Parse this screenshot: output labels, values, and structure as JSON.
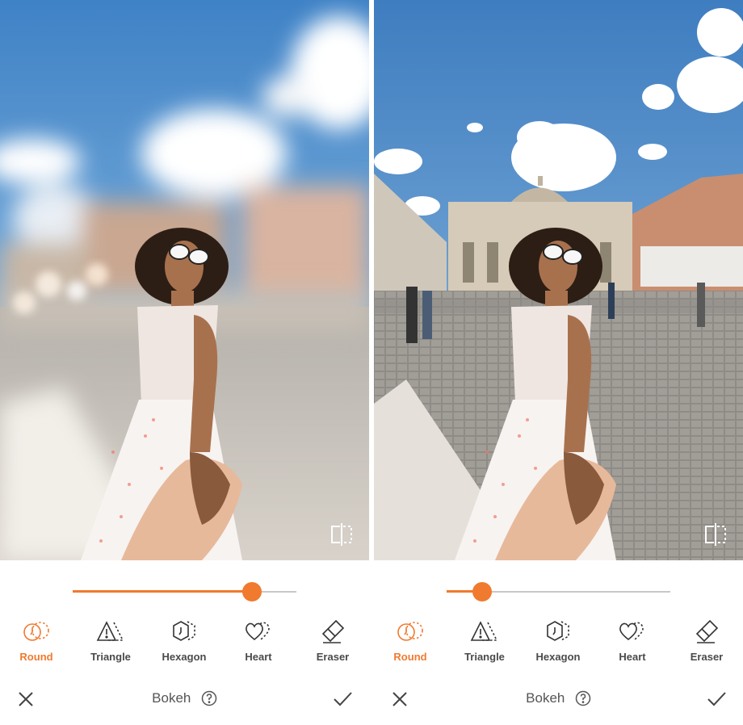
{
  "screens": [
    {
      "id": "left",
      "photo_variant": "bokeh-blurred",
      "slider_value": 0.8,
      "tools": [
        {
          "label": "Round",
          "icon": "round-bokeh-icon",
          "active": true
        },
        {
          "label": "Triangle",
          "icon": "triangle-bokeh-icon",
          "active": false
        },
        {
          "label": "Hexagon",
          "icon": "hexagon-bokeh-icon",
          "active": false
        },
        {
          "label": "Heart",
          "icon": "heart-bokeh-icon",
          "active": false
        },
        {
          "label": "Eraser",
          "icon": "eraser-icon",
          "active": false
        }
      ],
      "title": "Bokeh"
    },
    {
      "id": "right",
      "photo_variant": "original-sharp",
      "slider_value": 0.16,
      "tools": [
        {
          "label": "Round",
          "icon": "round-bokeh-icon",
          "active": true
        },
        {
          "label": "Triangle",
          "icon": "triangle-bokeh-icon",
          "active": false
        },
        {
          "label": "Hexagon",
          "icon": "hexagon-bokeh-icon",
          "active": false
        },
        {
          "label": "Heart",
          "icon": "heart-bokeh-icon",
          "active": false
        },
        {
          "label": "Eraser",
          "icon": "eraser-icon",
          "active": false
        }
      ],
      "title": "Bokeh"
    }
  ],
  "colors": {
    "accent": "#f07a2e",
    "sky": "#5b97d2",
    "text": "#4a4a4a"
  },
  "icons": {
    "compare": "compare-split-icon",
    "close": "close-icon",
    "help": "help-circle-icon",
    "confirm": "checkmark-icon"
  }
}
